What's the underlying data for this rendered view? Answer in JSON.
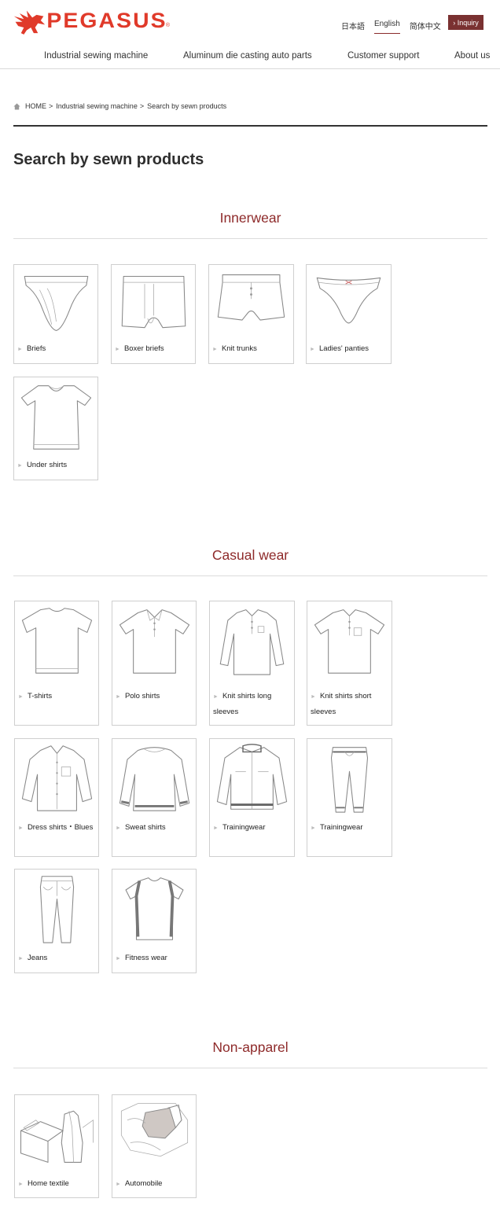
{
  "header": {
    "logo_text": "PEGASUS",
    "logo_mark": "®",
    "brand_color": "#e03a2a",
    "languages": [
      {
        "label": "日本語",
        "active": false
      },
      {
        "label": "English",
        "active": true
      },
      {
        "label": "简体中文",
        "active": false
      }
    ],
    "inquiry_label": "› Inquiry",
    "accent_color": "#7a3131"
  },
  "nav": {
    "items": [
      {
        "label": "Industrial sewing machine"
      },
      {
        "label": "Aluminum die casting auto parts"
      },
      {
        "label": "Customer support"
      },
      {
        "label": "About us"
      }
    ]
  },
  "breadcrumb": {
    "icon": "home-icon",
    "items": [
      "HOME",
      "Industrial sewing machine",
      "Search by sewn products"
    ],
    "separator": ">"
  },
  "page_title": "Search by sewn products",
  "sections": [
    {
      "title": "Innerwear",
      "items": [
        {
          "label": "Briefs",
          "icon": "briefs-illustration"
        },
        {
          "label": "Boxer briefs",
          "icon": "boxer-briefs-illustration"
        },
        {
          "label": "Knit trunks",
          "icon": "knit-trunks-illustration"
        },
        {
          "label": "Ladies' panties",
          "icon": "ladies-panties-illustration"
        },
        {
          "label": "Under shirts",
          "icon": "under-shirt-illustration"
        }
      ]
    },
    {
      "title": "Casual wear",
      "items": [
        {
          "label": "T-shirts",
          "icon": "t-shirt-illustration"
        },
        {
          "label": "Polo shirts",
          "icon": "polo-shirt-illustration"
        },
        {
          "label": "Knit shirts long sleeves",
          "icon": "knit-shirt-long-illustration"
        },
        {
          "label": "Knit shirts short sleeves",
          "icon": "knit-shirt-short-illustration"
        },
        {
          "label": "Dress shirts・Blues",
          "icon": "dress-shirt-illustration"
        },
        {
          "label": "Sweat shirts",
          "icon": "sweat-shirt-illustration"
        },
        {
          "label": "Trainingwear",
          "icon": "training-jacket-illustration"
        },
        {
          "label": "Trainingwear",
          "icon": "training-pants-illustration"
        },
        {
          "label": "Jeans",
          "icon": "jeans-illustration"
        },
        {
          "label": "Fitness wear",
          "icon": "fitness-wear-illustration"
        }
      ]
    },
    {
      "title": "Non-apparel",
      "items": [
        {
          "label": "Home textile",
          "icon": "home-textile-illustration"
        },
        {
          "label": "Automobile",
          "icon": "automobile-illustration"
        }
      ]
    }
  ],
  "colors": {
    "section_title": "#8e2a2a",
    "card_border": "#cfcfcf"
  }
}
